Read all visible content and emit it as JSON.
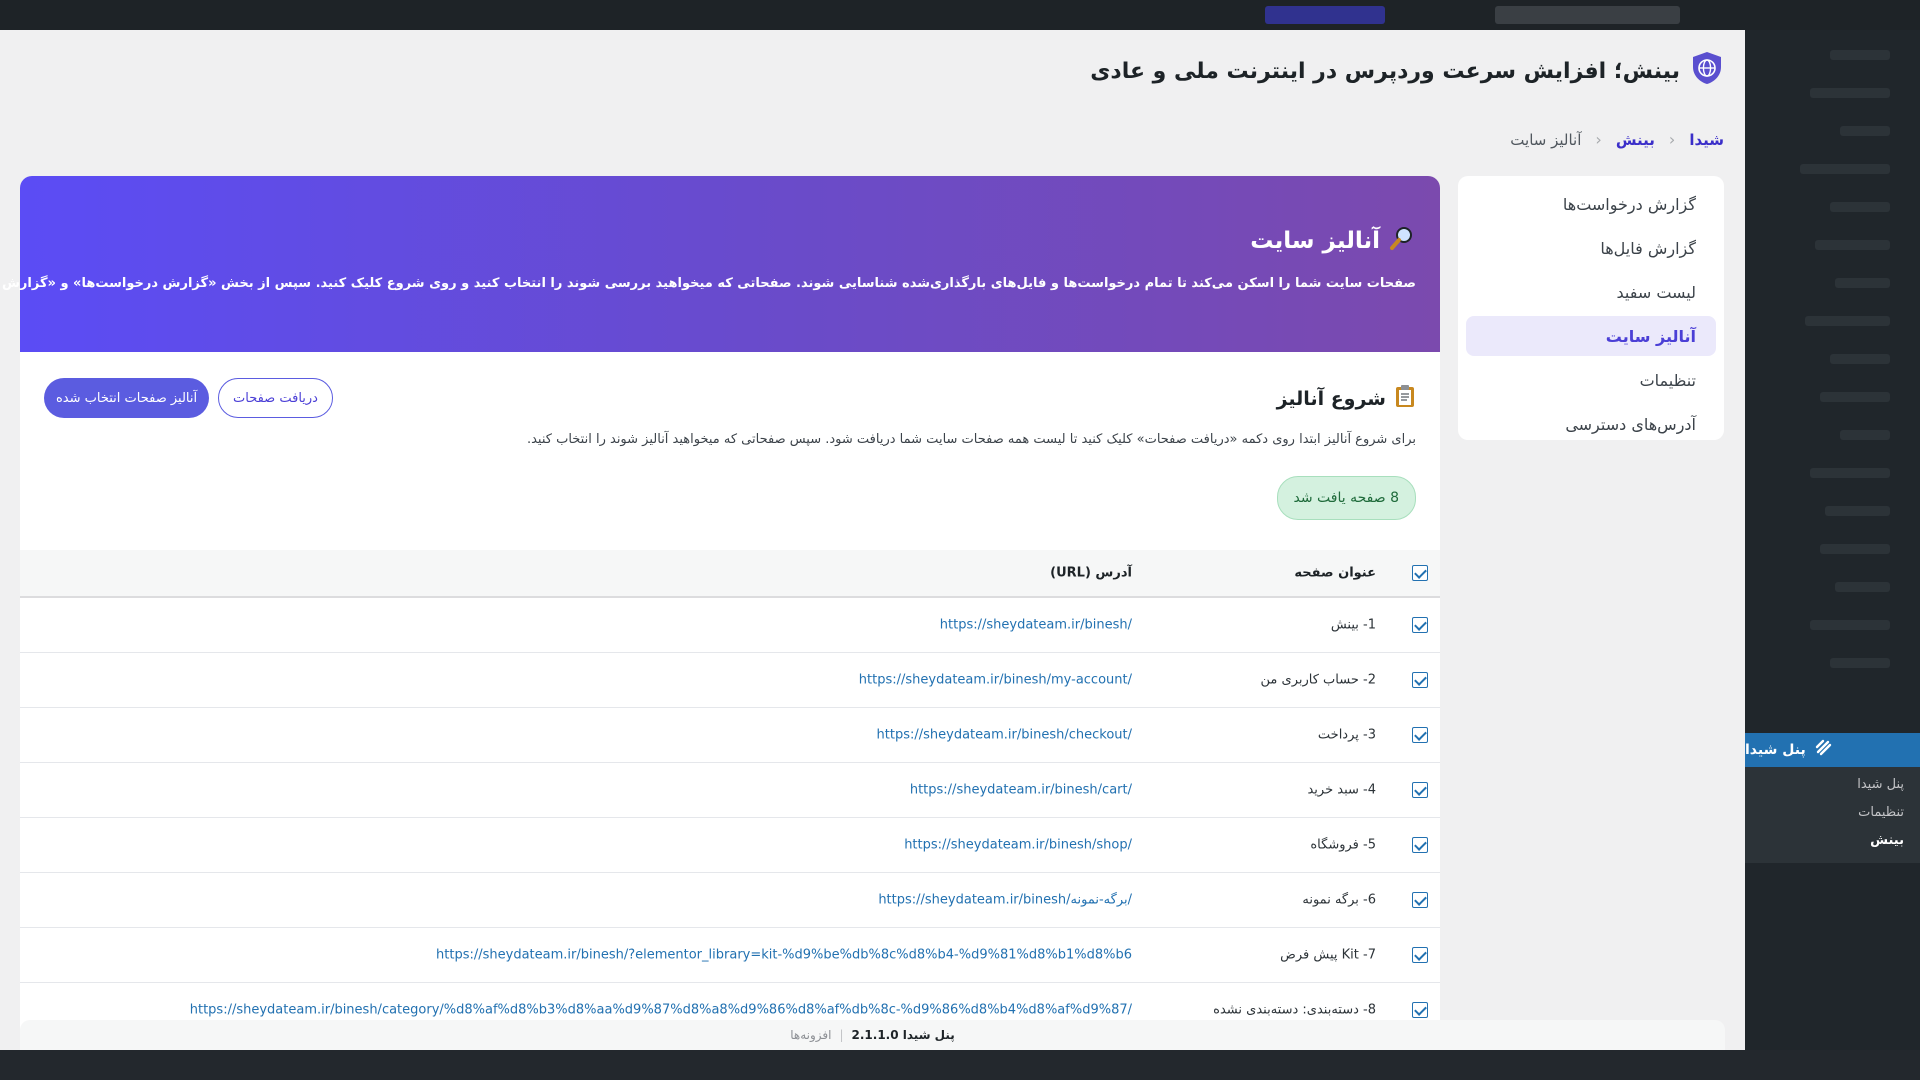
{
  "page_title": "بینش؛ افزایش سرعت وردپرس در اینترنت ملی و عادی",
  "breadcrumb": {
    "root": "شیدا",
    "parent": "بینش",
    "current": "آنالیز سایت"
  },
  "sidebar": {
    "items": [
      {
        "label": "گزارش درخواست‌ها",
        "active": false
      },
      {
        "label": "گزارش فایل‌ها",
        "active": false
      },
      {
        "label": "لیست سفید",
        "active": false
      },
      {
        "label": "آنالیز سایت",
        "active": true
      },
      {
        "label": "تنظیمات",
        "active": false
      },
      {
        "label": "آدرس‌های دسترسی",
        "active": false
      }
    ]
  },
  "hero": {
    "title": "آنالیز سایت",
    "description": "صفحات سایت شما را اسکن می‌کند تا تمام درخواست‌ها و فایل‌های بارگذاری‌شده شناسایی شوند. صفحاتی که میخواهید بررسی شوند را انتخاب کنید و روی شروع کلیک کنید. سپس از بخش «گزارش درخواست‌ها» و «گزارش فایل‌ها» نتایج را بررسی کنید."
  },
  "start": {
    "title": "شروع آنالیز",
    "description": "برای شروع آنالیز ابتدا روی دکمه «دریافت صفحات» کلیک کنید تا لیست همه صفحات سایت شما دریافت شود. سپس صفحاتی که میخواهید آنالیز شوند را انتخاب کنید.",
    "analyze_button": "آنالیز صفحات انتخاب شده",
    "fetch_button": "دریافت صفحات",
    "found_badge": "8 صفحه یافت شد"
  },
  "table": {
    "headers": {
      "title": "عنوان صفحه",
      "url": "آدرس (URL)"
    },
    "rows": [
      {
        "title": "1- بینش",
        "url": "https://sheydateam.ir/binesh/",
        "checked": true
      },
      {
        "title": "2- حساب کاربری من",
        "url": "https://sheydateam.ir/binesh/my-account/",
        "checked": true
      },
      {
        "title": "3- پرداخت",
        "url": "https://sheydateam.ir/binesh/checkout/",
        "checked": true
      },
      {
        "title": "4- سبد خرید",
        "url": "https://sheydateam.ir/binesh/cart/",
        "checked": true
      },
      {
        "title": "5- فروشگاه",
        "url": "https://sheydateam.ir/binesh/shop/",
        "checked": true
      },
      {
        "title": "6- برگه نمونه",
        "url": "https://sheydateam.ir/binesh/برگه-نمونه/",
        "checked": true
      },
      {
        "title": "7- Kit پیش فرض",
        "url": "https://sheydateam.ir/binesh/?elementor_library=kit-%d9%be%db%8c%d8%b4-%d9%81%d8%b1%d8%b6",
        "checked": true
      },
      {
        "title": "8- دسته‌بندی: دسته‌بندی نشده",
        "url": "https://sheydateam.ir/binesh/category/%d8%af%d8%b3%d8%aa%d9%87%d8%a8%d9%86%d8%af%db%8c-%d9%86%d8%b4%d8%af%d9%87/",
        "checked": true
      }
    ]
  },
  "wp_menu": {
    "header": "پنل شیدا",
    "subitems": [
      {
        "label": "پنل شیدا",
        "current": false
      },
      {
        "label": "تنظیمات",
        "current": false
      },
      {
        "label": "بینش",
        "current": true
      }
    ]
  },
  "footer": {
    "left": "افزونه‌ها",
    "version": "پنل شیدا 2.1.1.0"
  },
  "colors": {
    "accent": "#5b5ce0",
    "hero_start": "#5b4cf5",
    "hero_end": "#7b4aae",
    "wp_blue": "#2271b1"
  },
  "icons": {
    "title": "shield-globe-icon",
    "hero": "magnifier-icon",
    "start": "clipboard-icon",
    "menu": "sheida-logo-icon"
  }
}
